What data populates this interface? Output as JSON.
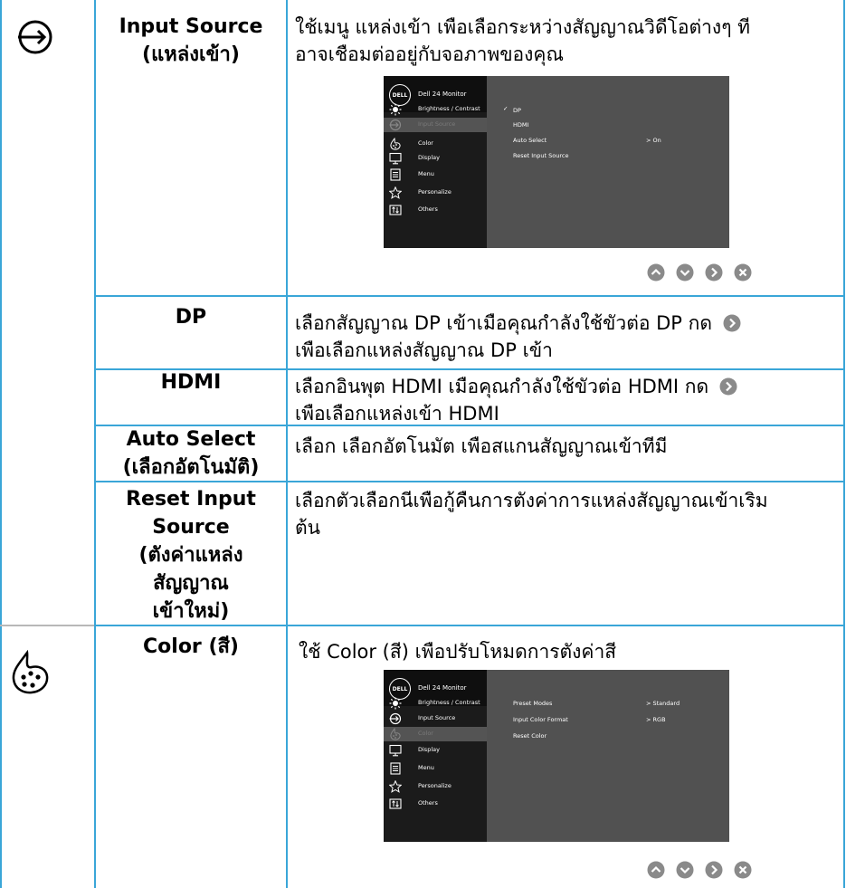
{
  "rows": {
    "input_source": {
      "icon": "input-source-icon",
      "term_line1": "Input Source",
      "term_line2": "(แหล่งเข้า)",
      "desc_line1": "ใช้เมนู แหล่งเข้า เพือเลือกระหว่างสัญญาณวิดีโอต่างๆ ที",
      "desc_line2": "อาจเชือมต่ออยู่กับจอภาพของคุณ"
    },
    "dp": {
      "term": "DP",
      "desc_line1": "เลือกสัญญาณ DP เข้าเมือคุณกำลังใช้ขัวต่อ DP กด",
      "desc_line2": "เพือเลือกแหล่งสัญญาณ DP เข้า"
    },
    "hdmi": {
      "term": "HDMI",
      "desc_line1": "เลือกอินพุต HDMI เมือคุณกำลังใช้ขัวต่อ HDMI กด",
      "desc_line2": "เพือเลือกแหล่งเข้า HDMI"
    },
    "auto_select": {
      "term_line1": "Auto Select",
      "term_line2": "(เลือกอัตโนมัติ)",
      "desc": "เลือก เลือกอัตโนมัต เพือสแกนสัญญาณเข้าทีมี"
    },
    "reset_input": {
      "term_lines": [
        "Reset Input",
        "Source",
        "(ตังค่าแหล่ง",
        "สัญญาณ",
        "เข้าใหม่)"
      ],
      "desc_line1": "เลือกตัวเลือกนีเพือกู้คืนการตังค่าการแหล่งสัญญาณเข้าเริม",
      "desc_line2": "ต้น"
    },
    "color": {
      "icon": "color-palette-icon",
      "term": "Color (สี)",
      "desc": "ใช้ Color (สี) เพือปรับโหมดการตังค่าสี"
    }
  },
  "osd": {
    "logo": "DELL",
    "model": "Dell 24 Monitor",
    "menu": [
      "Brightness / Contrast",
      "Input Source",
      "Color",
      "Display",
      "Menu",
      "Personalize",
      "Others"
    ],
    "menu_icons": [
      "brightness-icon",
      "input-source-icon",
      "color-icon",
      "display-icon",
      "menu-icon",
      "personalize-star-icon",
      "others-icon"
    ],
    "input_options": [
      "DP",
      "HDMI",
      "Auto Select",
      "Reset Input Source"
    ],
    "input_checkmark": "✓",
    "auto_select_value": "> On",
    "color_options": [
      "Preset Modes",
      "Input Color Format",
      "Reset Color"
    ],
    "preset_value": "> Standard",
    "input_color_value": "> RGB"
  },
  "nav_buttons": [
    "up-button-icon",
    "down-button-icon",
    "right-button-icon",
    "exit-button-icon"
  ]
}
